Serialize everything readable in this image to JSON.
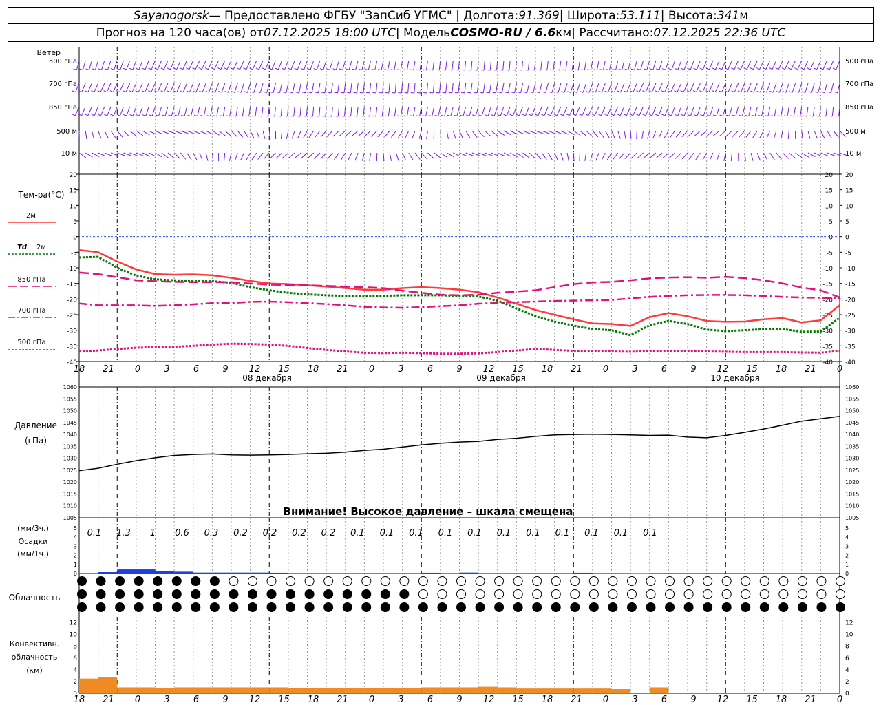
{
  "header": {
    "station": "Sayanogorsk",
    "provider": " — Предоставлено ФГБУ \"ЗапСиб УГМС\" | Долгота: ",
    "lon": "91.369",
    "lat_label": " | Широта: ",
    "lat": "53.111",
    "alt_label": " | Высота: ",
    "alt": "341",
    "alt_unit": "м",
    "forecast_prefix": "Прогноз на 120 часа(ов) от ",
    "forecast_date": "07.12.2025 18:00 UTC",
    "model_label": " | Модель ",
    "model": "COSMO-RU / 6.6",
    "model_unit": "км",
    "calc_label": " | Рассчитано: ",
    "calc_date": "07.12.2025 22:36 UTC"
  },
  "labels": {
    "wind": "Ветер",
    "levels": [
      "500 гПа",
      "700 гПа",
      "850 гПа",
      "500 м",
      "10 м"
    ],
    "temp_title": "Тем-ра(°C)",
    "t2m": "2м",
    "td": "Td",
    "td2m": "2м",
    "t850": "850 гПа",
    "t700": "700 гПа",
    "t500": "500 гПа",
    "pressure": "Давление",
    "pressure_unit": "(гПа)",
    "warning": "Внимание! Высокое давление – шкала смещена",
    "precip_3h": "(мм/3ч.)",
    "precip": "Осадки",
    "precip_1h": "(мм/1ч.)",
    "cloud": "Облачность",
    "conv1": "Конвективн.",
    "conv2": "облачность",
    "conv3": "(км)"
  },
  "hours": [
    "18",
    "21",
    "0",
    "3",
    "6",
    "9",
    "12",
    "15",
    "18",
    "21",
    "0",
    "3",
    "6",
    "9",
    "12",
    "15",
    "18",
    "21",
    "0",
    "3",
    "6",
    "9",
    "12",
    "15",
    "18",
    "21",
    "0"
  ],
  "days": [
    "08 декабря",
    "09 декабря",
    "10 декабря"
  ],
  "colors": {
    "t2m": "#ff3a3a",
    "td": "#007a00",
    "upper": "#e0117f",
    "wind": "#7b1fe0",
    "precip": "#1f3fe0",
    "conv": "#f08a24",
    "zero": "#3050ff"
  },
  "chart_data": [
    {
      "type": "line",
      "title": "Тем-ра(°C)",
      "x_hours_from_start": [
        0,
        3,
        6,
        9,
        12,
        15,
        18,
        21,
        24,
        27,
        30,
        33,
        36,
        39,
        42,
        45,
        48,
        51,
        54,
        57,
        60,
        63,
        66,
        69,
        72,
        75,
        78,
        81,
        84,
        87,
        90,
        93,
        96,
        99,
        102,
        105,
        108,
        111,
        114,
        117,
        120
      ],
      "ylim": [
        -40,
        20
      ],
      "series": [
        {
          "name": "2м",
          "values": [
            -4.3,
            -5,
            -8,
            -10.5,
            -12,
            -12.2,
            -12.1,
            -12.4,
            -13.2,
            -14.2,
            -15,
            -15.2,
            -15.6,
            -16,
            -16.5,
            -17,
            -17,
            -16.5,
            -16.2,
            -16.5,
            -17,
            -17.8,
            -19.5,
            -21.5,
            -23.5,
            -25,
            -26.5,
            -27.8,
            -28,
            -28.6,
            -25.8,
            -24.5,
            -25.5,
            -27,
            -27.3,
            -27.2,
            -26.5,
            -26.1,
            -27.5,
            -26.8,
            -22
          ]
        },
        {
          "name": "Td 2м",
          "values": [
            -6.7,
            -6.5,
            -10,
            -12.5,
            -13.7,
            -14,
            -14.2,
            -14.3,
            -14.8,
            -16.2,
            -17.2,
            -18,
            -18.5,
            -18.8,
            -19,
            -19.2,
            -19,
            -18.8,
            -18.8,
            -18.8,
            -19,
            -19.2,
            -20.5,
            -23,
            -25.5,
            -27.2,
            -28.5,
            -29.6,
            -30,
            -31.6,
            -28.4,
            -27,
            -28,
            -29.8,
            -30.3,
            -30,
            -29.7,
            -29.6,
            -30.5,
            -30.4,
            -26
          ]
        },
        {
          "name": "850 гПа",
          "values": [
            -11.5,
            -12,
            -13,
            -14,
            -14.3,
            -14.5,
            -14.6,
            -14.6,
            -14.6,
            -15,
            -15.4,
            -15.5,
            -15.6,
            -15.8,
            -16,
            -16.2,
            -16.5,
            -17.3,
            -18,
            -18.6,
            -18.8,
            -18.6,
            -18,
            -17.6,
            -17.2,
            -16.2,
            -15.2,
            -14.7,
            -14.5,
            -14,
            -13.4,
            -13.1,
            -13,
            -13.2,
            -12.9,
            -13.3,
            -14,
            -15,
            -16.3,
            -17.2,
            -19.5
          ]
        },
        {
          "name": "700 гПа",
          "values": [
            -21.4,
            -22,
            -22,
            -22,
            -22.2,
            -22,
            -21.7,
            -21.3,
            -21.3,
            -20.9,
            -20.8,
            -21,
            -21.3,
            -21.6,
            -22,
            -22.5,
            -22.7,
            -22.8,
            -22.6,
            -22.3,
            -22,
            -21.5,
            -21.2,
            -21,
            -20.8,
            -20.6,
            -20.5,
            -20.4,
            -20.3,
            -19.8,
            -19.3,
            -19,
            -18.8,
            -18.7,
            -18.7,
            -18.8,
            -19,
            -19.3,
            -19.5,
            -19.6,
            -19.8
          ]
        },
        {
          "name": "500 гПа",
          "values": [
            -36.8,
            -36.5,
            -36,
            -35.6,
            -35.4,
            -35.3,
            -35,
            -34.6,
            -34.3,
            -34.4,
            -34.6,
            -35,
            -35.7,
            -36.3,
            -36.8,
            -37.2,
            -37.3,
            -37.2,
            -37.3,
            -37.5,
            -37.5,
            -37.4,
            -37,
            -36.5,
            -36,
            -36.3,
            -36.6,
            -36.7,
            -36.8,
            -36.9,
            -36.7,
            -36.6,
            -36.7,
            -36.8,
            -36.9,
            -37,
            -37,
            -37,
            -37.1,
            -37.2,
            -36.6
          ]
        }
      ]
    },
    {
      "type": "line",
      "title": "Давление",
      "ylabel": "(гПа)",
      "ylim": [
        1005,
        1060
      ],
      "x_hours_from_start": [
        0,
        3,
        6,
        9,
        12,
        15,
        18,
        21,
        24,
        27,
        30,
        33,
        36,
        39,
        42,
        45,
        48,
        51,
        54,
        57,
        60,
        63,
        66,
        69,
        72,
        75,
        78,
        81,
        84,
        87,
        90,
        93,
        96,
        99,
        102,
        105,
        108,
        111,
        114,
        117,
        120
      ],
      "series": [
        {
          "name": "",
          "values": [
            1024.8,
            1025.8,
            1027.5,
            1029,
            1030.2,
            1031.2,
            1031.6,
            1031.8,
            1031.4,
            1031.3,
            1031.4,
            1031.6,
            1031.9,
            1032.1,
            1032.6,
            1033.3,
            1033.8,
            1034.7,
            1035.6,
            1036.3,
            1036.8,
            1037.1,
            1037.9,
            1038.4,
            1039.2,
            1039.8,
            1040,
            1040.1,
            1040,
            1039.8,
            1039.6,
            1039.7,
            1038.9,
            1038.6,
            1039.6,
            1040.9,
            1042.3,
            1043.9,
            1045.6,
            1046.6,
            1047.6
          ]
        }
      ]
    },
    {
      "type": "bar",
      "title": "Осадки",
      "ylabel": "(мм/1ч.)",
      "ylim": [
        0,
        5
      ],
      "x_hours_from_start": [
        0,
        3,
        6,
        9,
        12,
        15,
        18,
        21,
        24,
        27,
        30,
        33,
        36,
        39,
        42,
        45,
        48,
        51,
        54,
        57,
        60,
        63,
        66,
        69,
        72,
        75,
        78,
        81,
        84,
        87
      ],
      "series": [
        {
          "name": "мм/1ч.",
          "values": [
            0.05,
            0.15,
            0.45,
            0.45,
            0.3,
            0.2,
            0.1,
            0.1,
            0.1,
            0.1,
            0.08,
            0.05,
            0.05,
            0.05,
            0.05,
            0.05,
            0.05,
            0.05,
            0.08,
            0.05,
            0.1,
            0.05,
            0.05,
            0.05,
            0.05,
            0.05,
            0.08,
            0.05,
            0.05,
            0.03
          ]
        }
      ],
      "totals_3h": [
        "0.1",
        "1.3",
        "1",
        "0.6",
        "0.3",
        "0.2",
        "0.2",
        "0.2",
        "0.2",
        "0.1",
        "0.1",
        "0.1",
        "0.1",
        "0.1",
        "0.1",
        "0.1",
        "0.1",
        "0.1",
        "0.1",
        "0.1"
      ]
    },
    {
      "type": "bar",
      "title": "Конвективн. облачность",
      "ylabel": "(км)",
      "ylim": [
        0,
        13
      ],
      "x_hours_from_start": [
        0,
        3,
        6,
        9,
        12,
        15,
        18,
        21,
        24,
        27,
        30,
        33,
        36,
        39,
        42,
        45,
        48,
        51,
        54,
        57,
        60,
        63,
        66,
        69,
        72,
        75,
        78,
        81,
        84,
        87,
        90
      ],
      "series": [
        {
          "name": "км",
          "values": [
            2.5,
            2.8,
            1,
            1,
            0.9,
            1,
            1,
            1,
            1,
            1,
            1,
            0.9,
            0.9,
            0.9,
            0.9,
            0.9,
            0.9,
            0.9,
            1,
            1,
            1,
            1.1,
            1,
            0.8,
            0.8,
            0.8,
            0.8,
            0.8,
            0.7,
            0,
            1
          ]
        }
      ]
    }
  ]
}
